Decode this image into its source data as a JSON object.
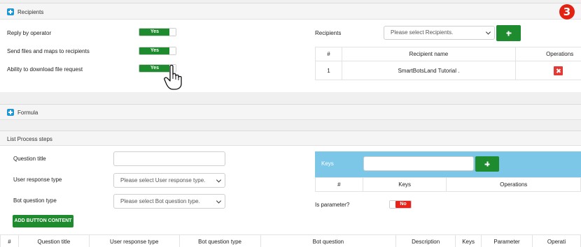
{
  "step_badge": "3",
  "recipients_panel": {
    "title": "Recipients",
    "options": [
      {
        "label": "Reply by operator",
        "value": "Yes"
      },
      {
        "label": "Send files and maps to recipients",
        "value": "Yes"
      },
      {
        "label": "Ability to download file request",
        "value": "Yes"
      }
    ],
    "recipients_label": "Recipients",
    "recipients_select": "Please select Recipients.",
    "table": {
      "headers": [
        "#",
        "Recipient name",
        "Operations"
      ],
      "rows": [
        {
          "num": "1",
          "name": "SmartBotsLand Tutorial ."
        }
      ]
    }
  },
  "formula_panel": {
    "title": "Formula"
  },
  "process_panel": {
    "title": "List Process steps",
    "question_title_label": "Question title",
    "user_response_label": "User response type",
    "user_response_select": "Please select User response type.",
    "bot_question_label": "Bot question type",
    "bot_question_select": "Please select Bot question type.",
    "add_button": "ADD BUTTON CONTENT",
    "keys_label": "Keys",
    "keys_table_headers": [
      "#",
      "Keys",
      "Operations"
    ],
    "is_parameter_label": "Is parameter?",
    "is_parameter_value": "No",
    "bottom_headers": [
      "#",
      "Question title",
      "User response type",
      "Bot question type",
      "Bot question",
      "Description",
      "Keys",
      "Parameter",
      "Operati"
    ]
  },
  "colors": {
    "green": "#1e8b2e",
    "red": "#e8231c",
    "blue": "#2196d3",
    "keys_bar": "#7cc6e8"
  }
}
